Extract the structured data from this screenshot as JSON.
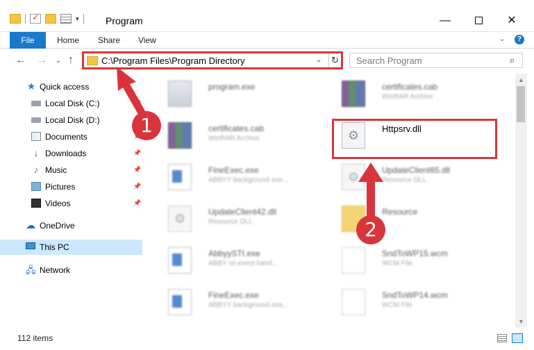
{
  "window": {
    "title": "Program",
    "minimize": "—",
    "close": "✕"
  },
  "ribbon": {
    "tabs": [
      "File",
      "Home",
      "Share",
      "View"
    ]
  },
  "address": {
    "path": "C:\\Program Files\\Program Directory",
    "dropdown": "⌄",
    "refresh": "↻"
  },
  "search": {
    "placeholder": "Search Program",
    "icon": "⌕"
  },
  "nav": {
    "back": "←",
    "forward": "→",
    "recent": "⌄",
    "up": "↑"
  },
  "sidebar": {
    "items": [
      {
        "label": "Quick access",
        "icon": "star-icon",
        "pinned": false
      },
      {
        "label": "Local Disk (C:)",
        "icon": "disk-icon",
        "pinned": true
      },
      {
        "label": "Local Disk (D:)",
        "icon": "disk-icon",
        "pinned": true
      },
      {
        "label": "Documents",
        "icon": "documents-icon",
        "pinned": true
      },
      {
        "label": "Downloads",
        "icon": "download-icon",
        "pinned": true
      },
      {
        "label": "Music",
        "icon": "music-icon",
        "pinned": true
      },
      {
        "label": "Pictures",
        "icon": "pictures-icon",
        "pinned": true
      },
      {
        "label": "Videos",
        "icon": "videos-icon",
        "pinned": true
      },
      {
        "label": "OneDrive",
        "icon": "cloud-icon",
        "pinned": false
      },
      {
        "label": "This PC",
        "icon": "computer-icon",
        "pinned": false,
        "selected": true
      },
      {
        "label": "Network",
        "icon": "network-icon",
        "pinned": false
      }
    ]
  },
  "files": [
    {
      "name": "program.exe",
      "type": "",
      "icon": "exe-icon"
    },
    {
      "name": "certificates.cab",
      "type": "WinRAR Archive",
      "icon": "archive-icon"
    },
    {
      "name": "certificates.cab",
      "type": "WinRAR Archive",
      "icon": "archive-icon"
    },
    {
      "name": "Httpsrv.dll",
      "type": "",
      "icon": "dll-icon"
    },
    {
      "name": "FineExec.exe",
      "type": "ABBYY background exe...",
      "icon": "app-icon"
    },
    {
      "name": "UpdateClient65.dll",
      "type": "Resource DLL",
      "icon": "dll-icon"
    },
    {
      "name": "UpdateClient42.dll",
      "type": "Resource DLL",
      "icon": "dll-icon"
    },
    {
      "name": "Resource",
      "type": "",
      "icon": "folder-icon"
    },
    {
      "name": "AbbyySTI.exe",
      "type": "ABBY sti event hand...",
      "icon": "app-icon"
    },
    {
      "name": "SndToWP15.wcm",
      "type": "WCM File",
      "icon": "wcm-icon"
    },
    {
      "name": "FineExec.exe",
      "type": "ABBYY background exe...",
      "icon": "app-icon"
    },
    {
      "name": "SndToWP14.wcm",
      "type": "WCM File",
      "icon": "wcm-icon"
    }
  ],
  "status": {
    "item_count": "112 items"
  },
  "annotations": {
    "step1": "1",
    "step2": "2",
    "color": "#d9343c"
  },
  "colors": {
    "accent": "#1979ca",
    "selection": "#cce8ff",
    "highlight": "#d9343c"
  }
}
